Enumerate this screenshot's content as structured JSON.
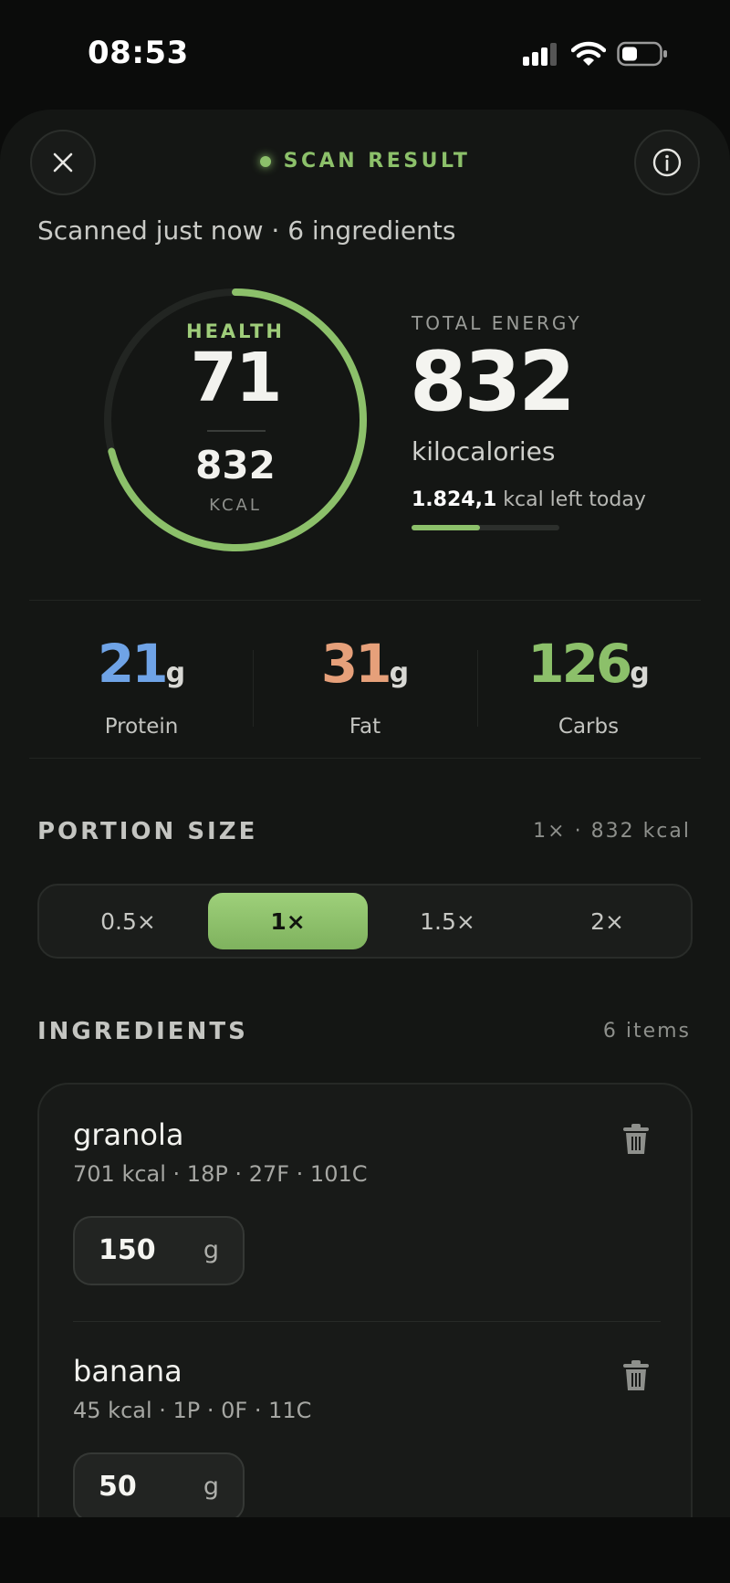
{
  "status_bar": {
    "time": "08:53",
    "icons": [
      "signal-icon",
      "wifi-icon",
      "battery-icon"
    ]
  },
  "header": {
    "title": "SCAN RESULT",
    "close_icon": "close-icon",
    "info_icon": "info-icon",
    "accent_color": "#8cc06a"
  },
  "scan_meta": "Scanned just now · 6 ingredients",
  "health": {
    "label": "HEALTH",
    "score": "71",
    "kcal": "832",
    "kcal_label": "KCAL",
    "score_fraction": 0.71
  },
  "energy": {
    "label": "TOTAL ENERGY",
    "value": "832",
    "unit": "kilocalories",
    "left_value": "1.824,1",
    "left_text": " kcal left today",
    "left_progress": 0.46
  },
  "macros": [
    {
      "value": "21",
      "unit": "g",
      "label": "Protein",
      "color": "#6fa3e6"
    },
    {
      "value": "31",
      "unit": "g",
      "label": "Fat",
      "color": "#e6a07a"
    },
    {
      "value": "126",
      "unit": "g",
      "label": "Carbs",
      "color": "#8cc06a"
    }
  ],
  "portion": {
    "title": "PORTION SIZE",
    "meta": "1× · 832 kcal",
    "options": [
      "0.5×",
      "1×",
      "1.5×",
      "2×"
    ],
    "selected": "1×"
  },
  "ingredients": {
    "title": "INGREDIENTS",
    "meta": "6 items",
    "items": [
      {
        "name": "granola",
        "stats": "701 kcal · 18P · 27F · 101C",
        "qty": "150",
        "unit": "g"
      },
      {
        "name": "banana",
        "stats": "45 kcal · 1P · 0F · 11C",
        "qty": "50",
        "unit": "g"
      }
    ]
  }
}
